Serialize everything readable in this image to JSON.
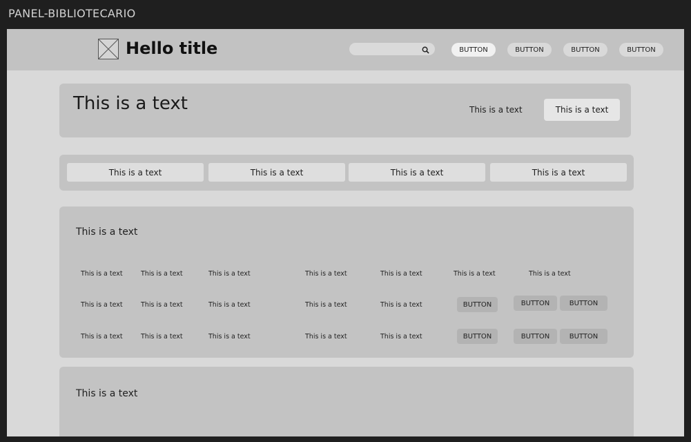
{
  "frame": {
    "title": "PANEL-BIBLIOTECARIO"
  },
  "header": {
    "title": "Hello title",
    "search": {
      "value": "",
      "placeholder": ""
    },
    "buttons": [
      "BUTTON",
      "BUTTON",
      "BUTTON",
      "BUTTON"
    ],
    "active_button": 0
  },
  "hero": {
    "title": "This is a text",
    "text": "This is a text",
    "button": "This is a text"
  },
  "tabs": [
    "This is a text",
    "This is a text",
    "This is a text",
    "This is a text"
  ],
  "table_section": {
    "title": "This is a text",
    "rows": [
      [
        "This is a text",
        "This is a text",
        "This is a text",
        "This is a text",
        "This is a text",
        "This is a text",
        "This is a text"
      ],
      [
        "This is a text",
        "This is a text",
        "This is a text",
        "This is a text",
        "This is a text",
        "BUTTON",
        "BUTTON",
        "BUTTON"
      ],
      [
        "This is a text",
        "This is a text",
        "This is a text",
        "This is a text",
        "This is a text",
        "BUTTON",
        "BUTTON",
        "BUTTON"
      ]
    ]
  },
  "bottom_section": {
    "title": "This is a text"
  },
  "icons": [
    "placeholder-image-icon",
    "search-icon"
  ]
}
